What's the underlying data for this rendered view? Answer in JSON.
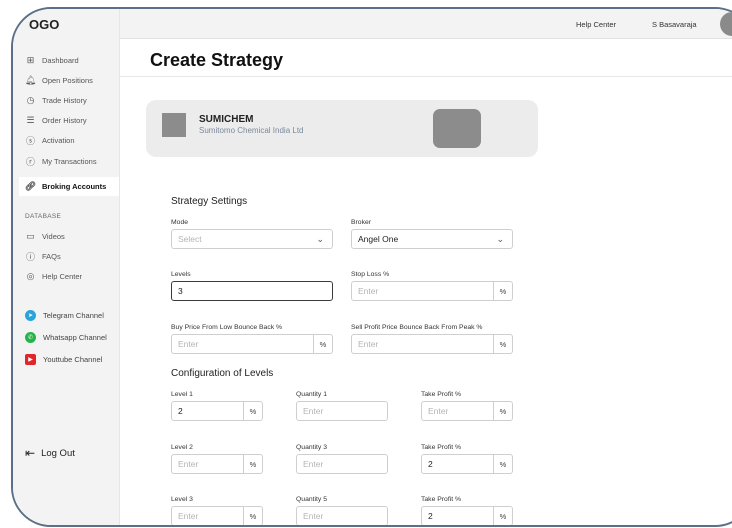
{
  "app": {
    "logo": "OGO"
  },
  "header": {
    "help_center": "Help Center",
    "user_name": "S Basavaraja"
  },
  "sidebar": {
    "items": [
      {
        "label": "Dashboard",
        "icon": "dashboard-icon"
      },
      {
        "label": "Open Positions",
        "icon": "bell-icon"
      },
      {
        "label": "Trade History",
        "icon": "clock-icon"
      },
      {
        "label": "Order History",
        "icon": "list-icon"
      },
      {
        "label": "Activation",
        "icon": "dollar-circle-icon"
      },
      {
        "label": "My Transactions",
        "icon": "rupee-circle-icon"
      },
      {
        "label": "Broking Accounts",
        "icon": "link-icon",
        "active": true
      }
    ],
    "database_label": "DATABASE",
    "database_items": [
      {
        "label": "Videos",
        "icon": "video-icon"
      },
      {
        "label": "FAQs",
        "icon": "question-icon"
      },
      {
        "label": "Help Center",
        "icon": "support-icon"
      }
    ],
    "channels": [
      {
        "label": "Telegram Channel",
        "icon": "telegram-icon",
        "color": "#2aa3d8"
      },
      {
        "label": "Whatsapp Channel",
        "icon": "whatsapp-icon",
        "color": "#27b34a"
      },
      {
        "label": "Youttube Channel",
        "icon": "youtube-icon",
        "color": "#e0262b"
      }
    ],
    "logout": "Log Out"
  },
  "page": {
    "title": "Create Strategy"
  },
  "stock": {
    "symbol": "SUMICHEM",
    "name": "Sumitomo Chemical India Ltd"
  },
  "settings": {
    "heading": "Strategy Settings",
    "mode": {
      "label": "Mode",
      "placeholder": "Select"
    },
    "broker": {
      "label": "Broker",
      "value": "Angel One"
    },
    "levels": {
      "label": "Levels",
      "value": "3"
    },
    "stop_loss": {
      "label": "Stop Loss %",
      "placeholder": "Enter",
      "suffix": "%"
    },
    "buy_price": {
      "label": "Buy Price From Low Bounce Back %",
      "placeholder": "Enter",
      "suffix": "%"
    },
    "sell_profit": {
      "label": "Sell Profit Price Bounce Back From Peak %",
      "placeholder": "Enter",
      "suffix": "%"
    }
  },
  "config": {
    "heading": "Configuration of Levels",
    "rows": [
      {
        "level_label": "Level 1",
        "level_value": "2",
        "qty_label": "Quantity 1",
        "qty_placeholder": "Enter",
        "tp_label": "Take Profit %",
        "tp_value": "",
        "tp_placeholder": "Enter"
      },
      {
        "level_label": "Level 2",
        "level_value": "",
        "level_placeholder": "Enter",
        "qty_label": "Quantity 3",
        "qty_placeholder": "Enter",
        "tp_label": "Take Profit %",
        "tp_value": "2"
      },
      {
        "level_label": "Level 3",
        "level_value": "",
        "level_placeholder": "Enter",
        "qty_label": "Quantity 5",
        "qty_placeholder": "Enter",
        "tp_label": "Take Profit %",
        "tp_value": "2"
      }
    ],
    "percent": "%"
  }
}
